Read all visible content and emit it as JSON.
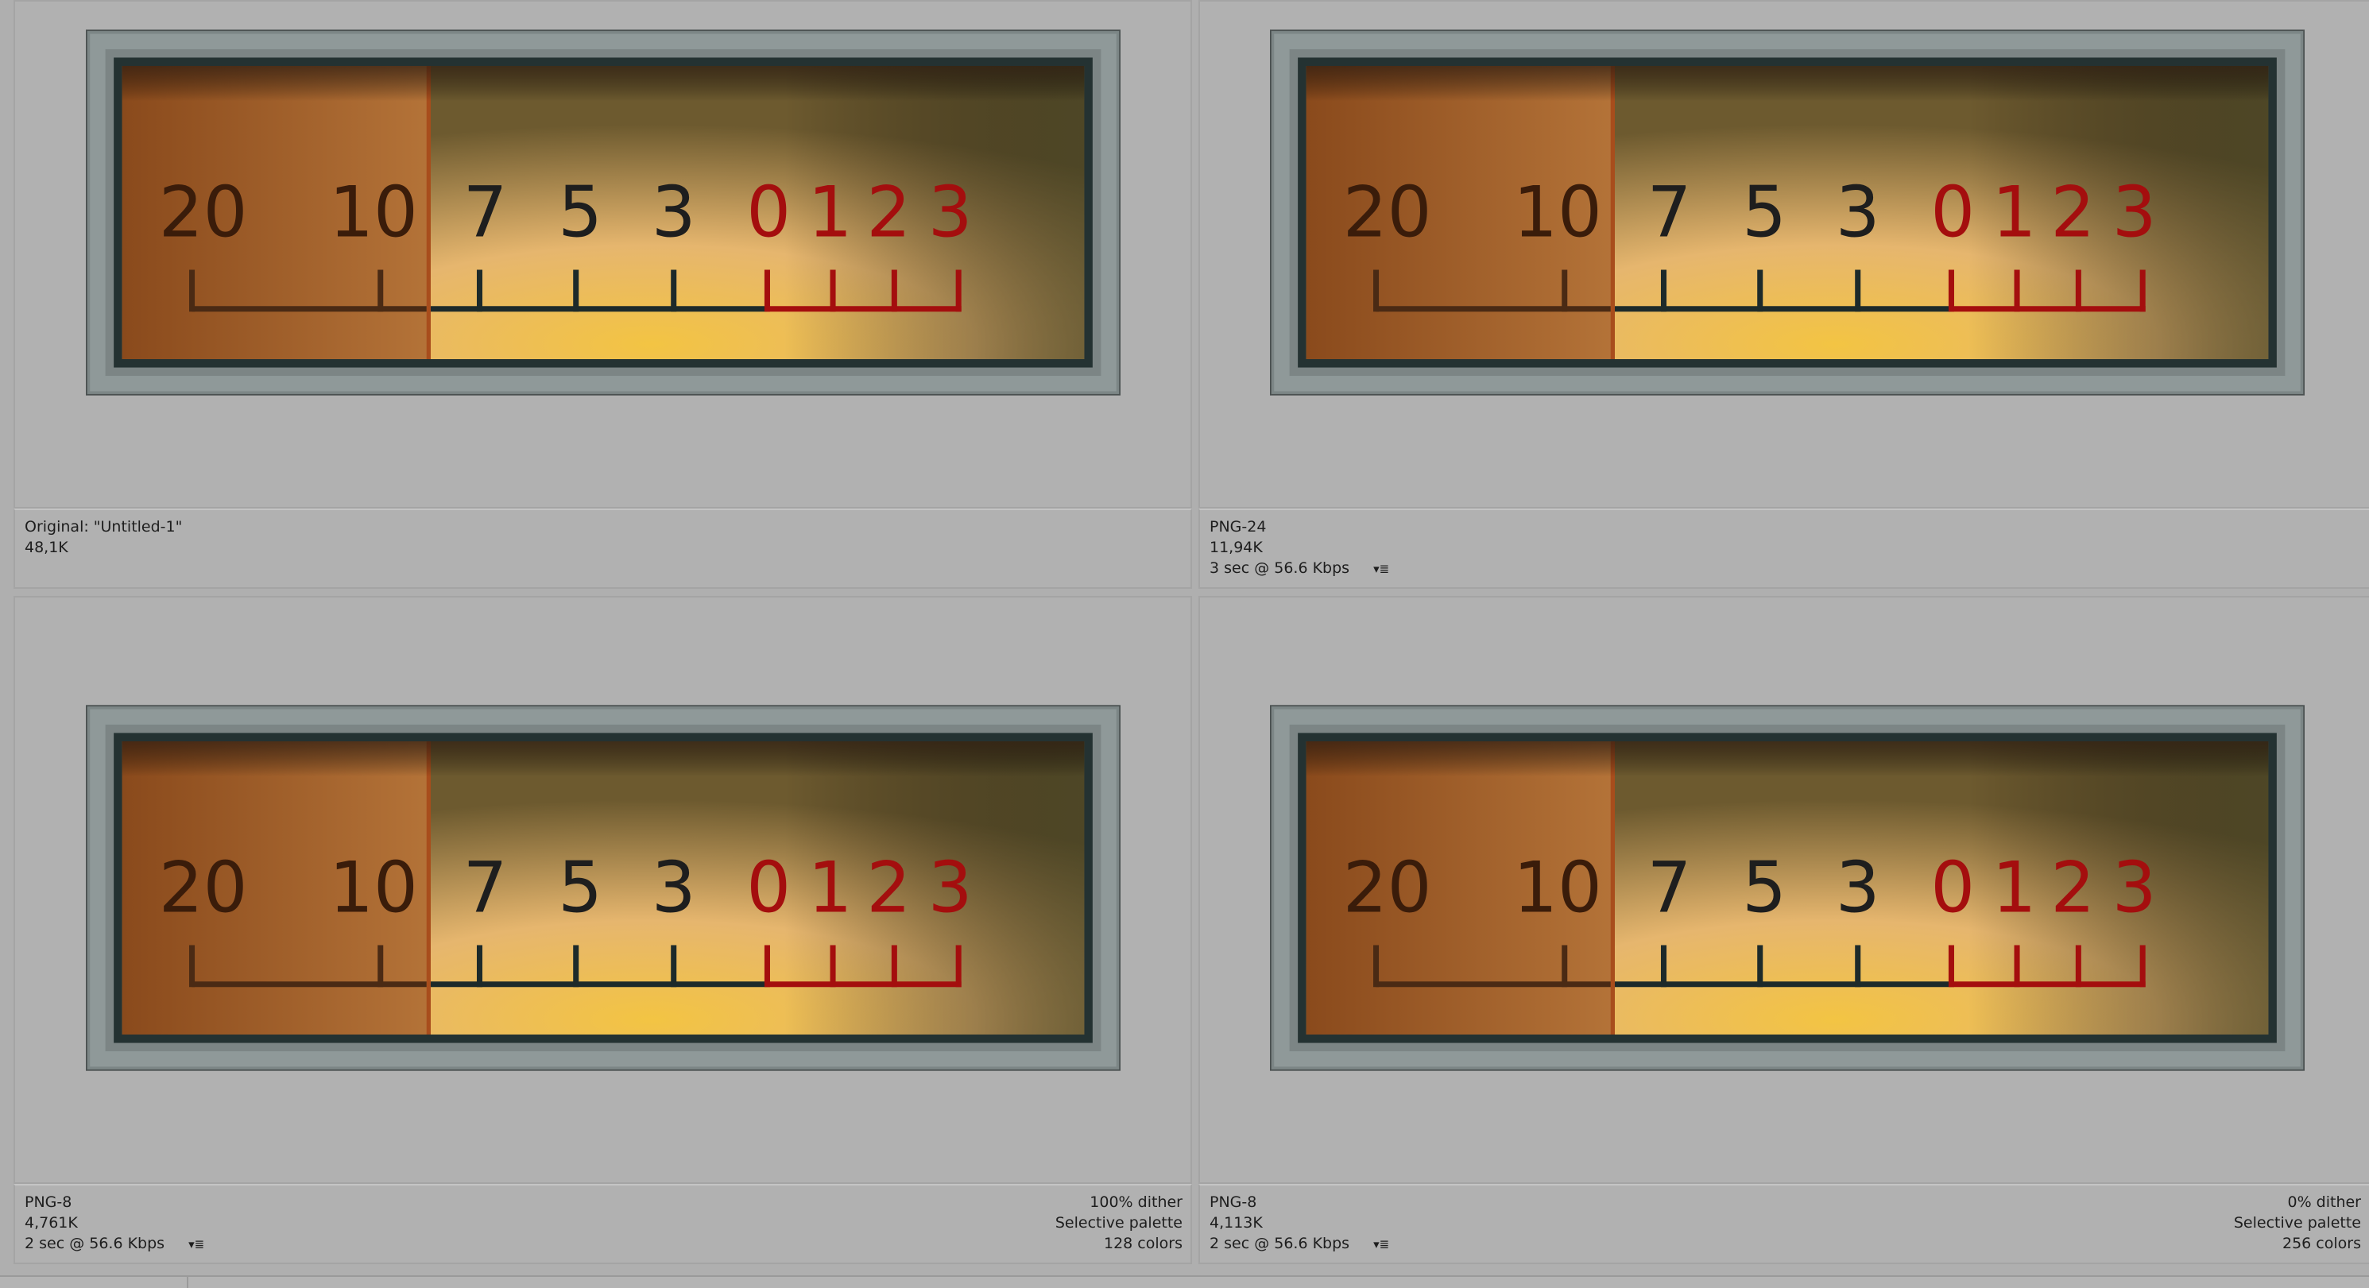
{
  "panels": [
    {
      "id": "original",
      "lines_left": [
        "Original: \"Untitled-1\"",
        "48,1K"
      ],
      "lines_right": [],
      "has_menu": false
    },
    {
      "id": "png24",
      "lines_left": [
        "PNG-24",
        "11,94K",
        "3 sec @ 56.6 Kbps"
      ],
      "lines_right": [],
      "has_menu": true
    },
    {
      "id": "png8-dither",
      "lines_left": [
        "PNG-8",
        "4,761K",
        "2 sec @ 56.6 Kbps"
      ],
      "lines_right": [
        "100% dither",
        "Selective palette",
        "128 colors"
      ],
      "has_menu": true
    },
    {
      "id": "png8-nodither",
      "lines_left": [
        "PNG-8",
        "4,113K",
        "2 sec @ 56.6 Kbps"
      ],
      "lines_right": [
        "0% dither",
        "Selective palette",
        "256 colors"
      ],
      "has_menu": true
    }
  ],
  "meter": {
    "labels_dark": [
      "20",
      "10",
      "7",
      "5",
      "3"
    ],
    "labels_red": [
      "0",
      "1",
      "2",
      "3"
    ]
  },
  "icons": {
    "menu": "optimize-menu-icon"
  },
  "colors": {
    "meter_red": "#a40e0e",
    "meter_dark": "#3a1c0a",
    "frame": "#7c8686"
  }
}
